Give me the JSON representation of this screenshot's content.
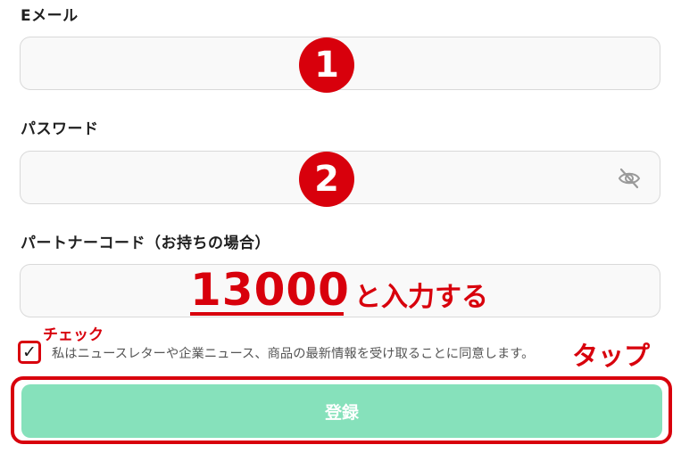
{
  "form": {
    "email": {
      "label": "Eメール",
      "value": "",
      "step": "1"
    },
    "password": {
      "label": "パスワード",
      "value": "",
      "step": "2",
      "toggle_icon": "eye-off-icon"
    },
    "partner_code": {
      "label": "パートナーコード（お持ちの場合）",
      "value": ""
    },
    "consent": {
      "checked": true,
      "text": "私はニュースレターや企業ニュース、商品の最新情報を受け取ることに同意します。"
    },
    "submit_label": "登録"
  },
  "annotations": {
    "partner_code_value": "13000",
    "partner_code_instruction": "と入力する",
    "check_label": "チェック",
    "tap_label": "タップ",
    "accent_color": "#d8000c"
  },
  "colors": {
    "button": "#86e1bb",
    "field_background": "#f9f9f9",
    "field_border": "#d9d9d9"
  }
}
